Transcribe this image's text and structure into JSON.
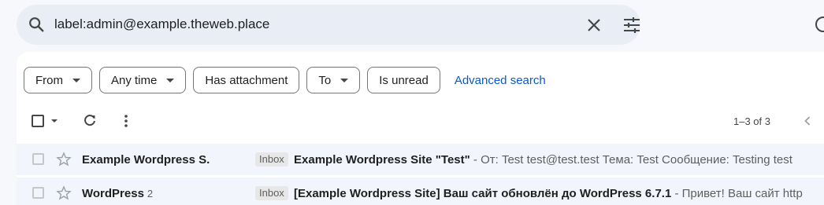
{
  "search": {
    "query": "label:admin@example.theweb.place",
    "icons": {
      "search": "search-icon",
      "clear": "close-icon",
      "options": "tune-icon",
      "help": "help-icon"
    }
  },
  "filters": {
    "chips": [
      {
        "label": "From",
        "dropdown": true
      },
      {
        "label": "Any time",
        "dropdown": true
      },
      {
        "label": "Has attachment",
        "dropdown": false
      },
      {
        "label": "To",
        "dropdown": true
      },
      {
        "label": "Is unread",
        "dropdown": false
      }
    ],
    "advanced_search": "Advanced search"
  },
  "toolbar": {
    "page_range": "1–3 of 3",
    "icons": [
      "checkbox-icon",
      "refresh-icon",
      "more-vert-icon",
      "chevron-left-icon"
    ]
  },
  "emails": [
    {
      "sender": "Example Wordpress S.",
      "count": "",
      "label": "Inbox",
      "subject": "Example Wordpress Site \"Test\"",
      "snippet": " - От: Test test@test.test Тема: Test Сообщение: Testing test"
    },
    {
      "sender": "WordPress",
      "count": "2",
      "label": "Inbox",
      "subject": "[Example Wordpress Site] Ваш сайт обновлён до WordPress 6.7.1",
      "snippet": " - Привет! Ваш сайт http"
    }
  ],
  "colors": {
    "accent": "#0b57d0",
    "search_bg": "#e9eef6",
    "page_bg": "#f6f8fc"
  }
}
